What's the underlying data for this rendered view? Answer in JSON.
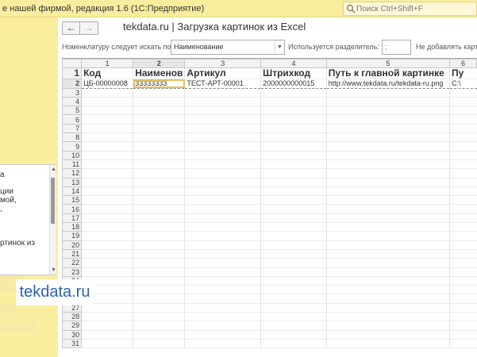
{
  "window": {
    "title": "е нашей фирмой, редакция 1.6  (1С:Предприятие)",
    "search_placeholder": "Поиск Ctrl+Shift+F"
  },
  "left_panel": {
    "items": [
      "а",
      "ции",
      "мой,",
      ",",
      "ртинок из"
    ]
  },
  "watermark": "tekdata.ru",
  "form": {
    "title": "tekdata.ru | Загрузка картинок из Excel",
    "back_label": "←",
    "forward_label": "→",
    "search_by_label": "Номенклатуру следует искать по:",
    "search_by_value": "Наименование",
    "separator_label": "Используется разделитель:",
    "separator_value": ";",
    "no_add_label": "Не добавлять картин"
  },
  "grid": {
    "column_numbers": [
      "",
      "1",
      "2",
      "3",
      "4",
      "5",
      "6"
    ],
    "active_column": 2,
    "active_row": 2,
    "header_row": [
      "Код",
      "Наименов",
      "Артикул",
      "Штрихкод",
      "Путь к главной картинке",
      "Пу"
    ],
    "data_row": [
      "ЦБ-00000008",
      "33333333",
      "ТЕСТ-АРТ-00001",
      "2000000000015",
      "http://www.tekdata.ru/tekdata-ru.png",
      "C:\\"
    ],
    "row_count": 31
  },
  "icons": {
    "search": "magnifier-icon",
    "back": "arrow-left-icon",
    "forward": "arrow-right-icon",
    "dropdown": "chevron-down-icon"
  }
}
